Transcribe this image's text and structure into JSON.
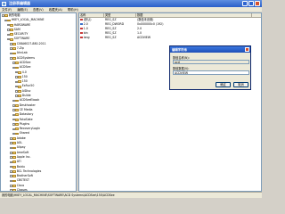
{
  "window": {
    "title": "注册表编辑器"
  },
  "menu": [
    "文件(F)",
    "编辑(E)",
    "查看(V)",
    "收藏夹(A)",
    "帮助(H)"
  ],
  "tree": [
    {
      "label": "我的电脑",
      "indent": 0
    },
    {
      "label": "HKEY_LOCAL_MACHINE",
      "indent": 1
    },
    {
      "label": "HARDWARE",
      "indent": 2
    },
    {
      "label": "SAM",
      "indent": 2
    },
    {
      "label": "SECURITY",
      "indent": 2
    },
    {
      "label": "SOFTWARE",
      "indent": 2
    },
    {
      "label": "C08A6027-880-2011",
      "indent": 3
    },
    {
      "label": "7-Zip",
      "indent": 3
    },
    {
      "label": "AhnLab",
      "indent": 3
    },
    {
      "label": "ACDSystems",
      "indent": 3
    },
    {
      "label": "ACDSee",
      "indent": 4
    },
    {
      "label": "ACDSee",
      "indent": 4
    },
    {
      "label": "4.0",
      "indent": 5
    },
    {
      "label": "150",
      "indent": 5
    },
    {
      "label": "150",
      "indent": 5
    },
    {
      "label": "ExFun50",
      "indent": 5
    },
    {
      "label": "AlDisc",
      "indent": 5
    },
    {
      "label": "Dslide",
      "indent": 5
    },
    {
      "label": "ACDSeeEbook",
      "indent": 4
    },
    {
      "label": "Deskhoster",
      "indent": 4
    },
    {
      "label": "CE Media",
      "indent": 4
    },
    {
      "label": "Datastory",
      "indent": 4
    },
    {
      "label": "FotoSlate",
      "indent": 4
    },
    {
      "label": "PlugIns",
      "indent": 4
    },
    {
      "label": "RecoveryLogIn",
      "indent": 4
    },
    {
      "label": "Shared",
      "indent": 4
    },
    {
      "label": "Adobe",
      "indent": 3
    },
    {
      "label": "AOL",
      "indent": 3
    },
    {
      "label": "Alipay",
      "indent": 3
    },
    {
      "label": "AmeSoft",
      "indent": 3
    },
    {
      "label": "Apple Inc.",
      "indent": 3
    },
    {
      "label": "ATI",
      "indent": 3
    },
    {
      "label": "Baidu",
      "indent": 3
    },
    {
      "label": "BCL Technologies",
      "indent": 3
    },
    {
      "label": "BrotherSoft",
      "indent": 3
    },
    {
      "label": "CBSTEST",
      "indent": 3
    },
    {
      "label": "Cisco",
      "indent": 3
    },
    {
      "label": "Classes",
      "indent": 3
    },
    {
      "label": "Clients",
      "indent": 3
    }
  ],
  "list": {
    "headers": [
      "名称",
      "类型",
      "数据"
    ],
    "rows": [
      {
        "name": "(默认)",
        "type": "REG_SZ",
        "data": "(数值未设置)",
        "icon": "string"
      },
      {
        "name": "2.0",
        "type": "REG_DWORD",
        "data": "0x000000c0 (192)",
        "icon": "binary"
      },
      {
        "name": "1.0",
        "type": "REG_SZ",
        "data": "2.0",
        "icon": "string"
      },
      {
        "name": "bin",
        "type": "REG_SZ",
        "data": "1.0",
        "icon": "string"
      },
      {
        "name": "lang",
        "type": "REG_SZ",
        "data": "ACDVIEW",
        "icon": "string"
      }
    ]
  },
  "dialog": {
    "title": "编辑字符串",
    "name_label": "数值名称(N):",
    "name_value": "ocd",
    "data_label": "数值数据(V):",
    "data_value": "ACDVIEW",
    "ok": "确定",
    "cancel": "取消"
  },
  "status": "我的电脑\\HKEY_LOCAL_MACHINE\\SOFTWARE\\ACD Systems\\ACDSee\\150\\ACDSee"
}
